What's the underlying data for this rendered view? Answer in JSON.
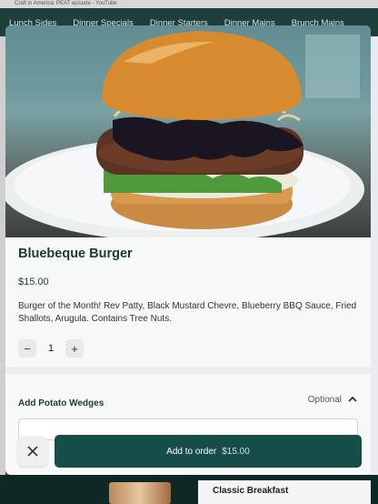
{
  "browser": {
    "tab_text": "Craft in America: PEAT episode - YouTube"
  },
  "nav": {
    "tabs": [
      "Lunch Sides",
      "Dinner Specials",
      "Dinner Starters",
      "Dinner Mains",
      "Brunch Mains"
    ]
  },
  "background": {
    "card_title": "Classic Breakfast"
  },
  "item": {
    "name": "Bluebeque Burger",
    "price": "$15.00",
    "description": "Burger of the Month! Rev Patty, Black Mustard Chevre, Blueberry BBQ Sauce, Fried Shallots, Arugula. Contains Tree Nuts.",
    "quantity": "1"
  },
  "stepper": {
    "minus": "−",
    "plus": "+"
  },
  "options": {
    "group_title": "Add Potato Wedges",
    "optional_label": "Optional"
  },
  "footer": {
    "add_label": "Add to order",
    "add_amount": "$15.00"
  },
  "colors": {
    "brand": "#164d49",
    "title": "#163b39",
    "nav_bg": "#1f3f3c"
  },
  "icons": {
    "close": "close-icon",
    "chevron": "chevron-up-icon"
  }
}
